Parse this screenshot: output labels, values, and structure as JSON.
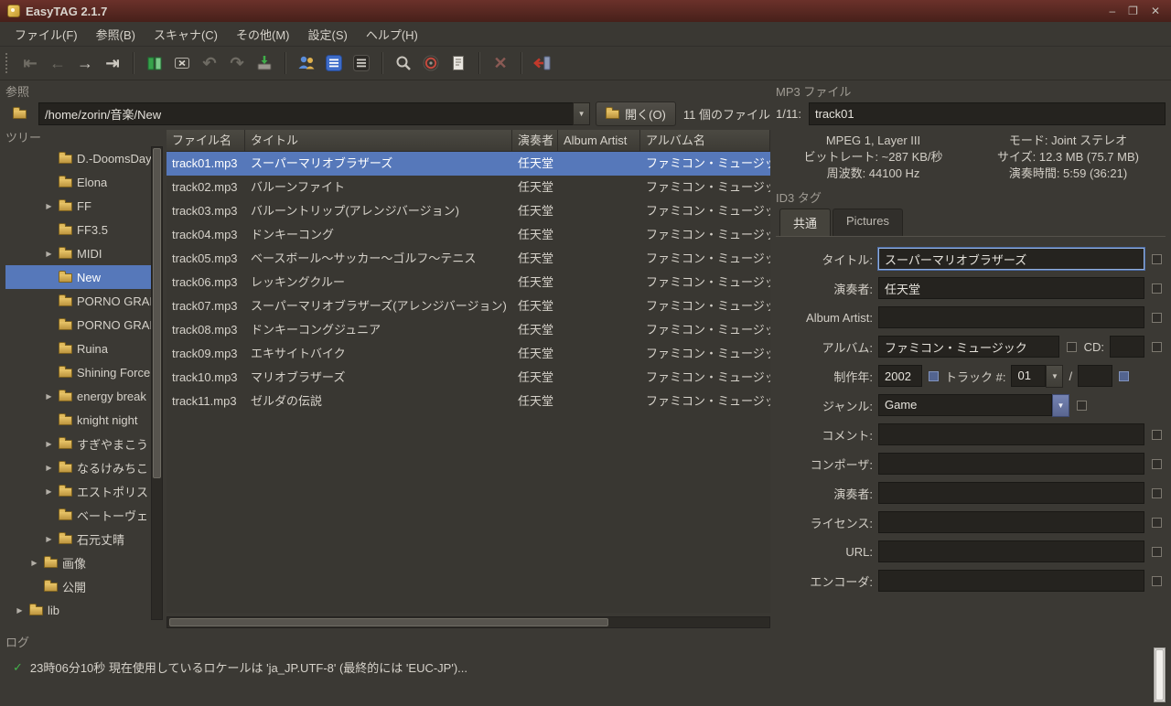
{
  "window": {
    "title": "EasyTAG 2.1.7",
    "minimize": "–",
    "maximize": "❐",
    "close": "✕"
  },
  "menubar": {
    "items": [
      "ファイル(F)",
      "参照(B)",
      "スキャナ(C)",
      "その他(M)",
      "設定(S)",
      "ヘルプ(H)"
    ]
  },
  "toolbar": {
    "first": "⇤",
    "prev": "←",
    "next": "→",
    "last": "⇥",
    "undo": "↶",
    "redo": "↷",
    "stop": "✕"
  },
  "icons": {
    "expander": "▶",
    "dropdown": "▼",
    "check": "✓"
  },
  "browse": {
    "frame_label": "参照",
    "path_value": "/home/zorin/音楽/New",
    "open_button_label": "開く(O)",
    "files_count": "11 個のファイル"
  },
  "tree": {
    "frame_label": "ツリー",
    "items": [
      {
        "label": "D.-DoomsDay",
        "selected": false
      },
      {
        "label": "Elona",
        "selected": false
      },
      {
        "label": "FF",
        "selected": false
      },
      {
        "label": "FF3.5",
        "selected": false
      },
      {
        "label": "MIDI",
        "selected": false
      },
      {
        "label": "New",
        "selected": true
      },
      {
        "label": "PORNO GRAF",
        "selected": false
      },
      {
        "label": "PORNO GRAF",
        "selected": false
      },
      {
        "label": "Ruina",
        "selected": false
      },
      {
        "label": "Shining Force",
        "selected": false
      },
      {
        "label": "energy break",
        "selected": false
      },
      {
        "label": "knight night",
        "selected": false
      },
      {
        "label": "すぎやまこう",
        "selected": false
      },
      {
        "label": "なるけみちこ",
        "selected": false
      },
      {
        "label": "エストポリス",
        "selected": false
      },
      {
        "label": "ベートーヴェ",
        "selected": false
      },
      {
        "label": "石元丈晴",
        "selected": false
      },
      {
        "label": "画像",
        "selected": false
      },
      {
        "label": "公開",
        "selected": false
      },
      {
        "label": "lib",
        "selected": false
      }
    ]
  },
  "filelist": {
    "columns": [
      "ファイル名",
      "タイトル",
      "演奏者",
      "Album Artist",
      "アルバム名"
    ],
    "rows": [
      {
        "file": "track01.mp3",
        "title": "スーパーマリオブラザーズ",
        "artist": "任天堂",
        "album_artist": "",
        "album": "ファミコン・ミュージック",
        "selected": true
      },
      {
        "file": "track02.mp3",
        "title": "バルーンファイト",
        "artist": "任天堂",
        "album_artist": "",
        "album": "ファミコン・ミュージック",
        "selected": false
      },
      {
        "file": "track03.mp3",
        "title": "バルーントリップ(アレンジバージョン)",
        "artist": "任天堂",
        "album_artist": "",
        "album": "ファミコン・ミュージック",
        "selected": false
      },
      {
        "file": "track04.mp3",
        "title": "ドンキーコング",
        "artist": "任天堂",
        "album_artist": "",
        "album": "ファミコン・ミュージック",
        "selected": false
      },
      {
        "file": "track05.mp3",
        "title": "ベースボール〜サッカー〜ゴルフ〜テニス",
        "artist": "任天堂",
        "album_artist": "",
        "album": "ファミコン・ミュージック",
        "selected": false
      },
      {
        "file": "track06.mp3",
        "title": "レッキングクルー",
        "artist": "任天堂",
        "album_artist": "",
        "album": "ファミコン・ミュージック",
        "selected": false
      },
      {
        "file": "track07.mp3",
        "title": "スーパーマリオブラザーズ(アレンジバージョン)",
        "artist": "任天堂",
        "album_artist": "",
        "album": "ファミコン・ミュージック",
        "selected": false
      },
      {
        "file": "track08.mp3",
        "title": "ドンキーコングジュニア",
        "artist": "任天堂",
        "album_artist": "",
        "album": "ファミコン・ミュージック",
        "selected": false
      },
      {
        "file": "track09.mp3",
        "title": "エキサイトバイク",
        "artist": "任天堂",
        "album_artist": "",
        "album": "ファミコン・ミュージック",
        "selected": false
      },
      {
        "file": "track10.mp3",
        "title": "マリオブラザーズ",
        "artist": "任天堂",
        "album_artist": "",
        "album": "ファミコン・ミュージック",
        "selected": false
      },
      {
        "file": "track11.mp3",
        "title": "ゼルダの伝説",
        "artist": "任天堂",
        "album_artist": "",
        "album": "ファミコン・ミュージック",
        "selected": false
      }
    ]
  },
  "mp3": {
    "frame_label": "MP3 ファイル",
    "index_label": "1/11:",
    "filename": "track01",
    "format": "MPEG 1, Layer III",
    "mode": "モード: Joint ステレオ",
    "bitrate": "ビットレート: ~287 KB/秒",
    "size": "サイズ: 12.3 MB (75.7 MB)",
    "frequency": "周波数: 44100 Hz",
    "duration": "演奏時間: 5:59 (36:21)"
  },
  "id3": {
    "frame_label": "ID3 タグ",
    "tab_common": "共通",
    "tab_pictures": "Pictures",
    "title_label": "タイトル:",
    "title_value": "スーパーマリオブラザーズ",
    "artist_label": "演奏者:",
    "artist_value": "任天堂",
    "album_artist_label": "Album Artist:",
    "album_artist_value": "",
    "album_label": "アルバム:",
    "album_value": "ファミコン・ミュージック",
    "cd_label": "CD:",
    "cd_value": "",
    "year_label": "制作年:",
    "year_value": "2002",
    "track_label": "トラック #:",
    "track_value": "01",
    "track_sep": "/",
    "track_total": "",
    "genre_label": "ジャンル:",
    "genre_value": "Game",
    "comment_label": "コメント:",
    "comment_value": "",
    "composer_label": "コンポーザ:",
    "composer_value": "",
    "orig_artist_label": "演奏者:",
    "orig_artist_value": "",
    "license_label": "ライセンス:",
    "license_value": "",
    "url_label": "URL:",
    "url_value": "",
    "encoder_label": "エンコーダ:",
    "encoder_value": ""
  },
  "log": {
    "frame_label": "ログ",
    "entry": "23時06分10秒 現在使用しているロケールは 'ja_JP.UTF-8' (最終的には 'EUC-JP')..."
  }
}
